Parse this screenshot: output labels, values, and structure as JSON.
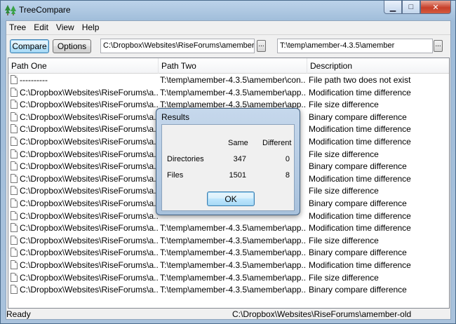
{
  "window": {
    "title": "TreeCompare"
  },
  "menu": [
    "Tree",
    "Edit",
    "View",
    "Help"
  ],
  "toolbar": {
    "compare_label": "Compare",
    "options_label": "Options",
    "path_one": "C:\\Dropbox\\Websites\\RiseForums\\amember-old",
    "path_two": "T:\\temp\\amember-4.3.5\\amember",
    "browse_label": "..."
  },
  "columns": [
    "Path One",
    "Path Two",
    "Description"
  ],
  "rows": [
    {
      "p1": "----------",
      "p2": "T:\\temp\\amember-4.3.5\\amember\\con...",
      "desc": "File path two does not exist"
    },
    {
      "p1": "C:\\Dropbox\\Websites\\RiseForums\\a...",
      "p2": "T:\\temp\\amember-4.3.5\\amember\\app...",
      "desc": "Modification time difference"
    },
    {
      "p1": "C:\\Dropbox\\Websites\\RiseForums\\a...",
      "p2": "T:\\temp\\amember-4.3.5\\amember\\app...",
      "desc": "File size difference"
    },
    {
      "p1": "C:\\Dropbox\\Websites\\RiseForums\\a...",
      "p2": "",
      "desc": "Binary compare difference"
    },
    {
      "p1": "C:\\Dropbox\\Websites\\RiseForums\\a...",
      "p2": "",
      "desc": "Modification time difference"
    },
    {
      "p1": "C:\\Dropbox\\Websites\\RiseForums\\a...",
      "p2": "",
      "desc": "Modification time difference"
    },
    {
      "p1": "C:\\Dropbox\\Websites\\RiseForums\\a...",
      "p2": "",
      "desc": "File size difference"
    },
    {
      "p1": "C:\\Dropbox\\Websites\\RiseForums\\a...",
      "p2": "",
      "desc": "Binary compare difference"
    },
    {
      "p1": "C:\\Dropbox\\Websites\\RiseForums\\a...",
      "p2": "",
      "desc": "Modification time difference"
    },
    {
      "p1": "C:\\Dropbox\\Websites\\RiseForums\\a...",
      "p2": "",
      "desc": "File size difference"
    },
    {
      "p1": "C:\\Dropbox\\Websites\\RiseForums\\a...",
      "p2": "",
      "desc": "Binary compare difference"
    },
    {
      "p1": "C:\\Dropbox\\Websites\\RiseForums\\a...",
      "p2": "",
      "desc": "Modification time difference"
    },
    {
      "p1": "C:\\Dropbox\\Websites\\RiseForums\\a...",
      "p2": "T:\\temp\\amember-4.3.5\\amember\\app...",
      "desc": "Modification time difference"
    },
    {
      "p1": "C:\\Dropbox\\Websites\\RiseForums\\a...",
      "p2": "T:\\temp\\amember-4.3.5\\amember\\app...",
      "desc": "File size difference"
    },
    {
      "p1": "C:\\Dropbox\\Websites\\RiseForums\\a...",
      "p2": "T:\\temp\\amember-4.3.5\\amember\\app...",
      "desc": "Binary compare difference"
    },
    {
      "p1": "C:\\Dropbox\\Websites\\RiseForums\\a...",
      "p2": "T:\\temp\\amember-4.3.5\\amember\\app...",
      "desc": "Modification time difference"
    },
    {
      "p1": "C:\\Dropbox\\Websites\\RiseForums\\a...",
      "p2": "T:\\temp\\amember-4.3.5\\amember\\app...",
      "desc": "File size difference"
    },
    {
      "p1": "C:\\Dropbox\\Websites\\RiseForums\\a...",
      "p2": "T:\\temp\\amember-4.3.5\\amember\\app...",
      "desc": "Binary compare difference"
    }
  ],
  "status": {
    "left": "Ready",
    "right": "C:\\Dropbox\\Websites\\RiseForums\\amember-old"
  },
  "dialog": {
    "title": "Results",
    "col_same": "Same",
    "col_different": "Different",
    "rows": [
      {
        "label": "Directories",
        "same": "347",
        "different": "0"
      },
      {
        "label": "Files",
        "same": "1501",
        "different": "8"
      }
    ],
    "ok_label": "OK"
  }
}
